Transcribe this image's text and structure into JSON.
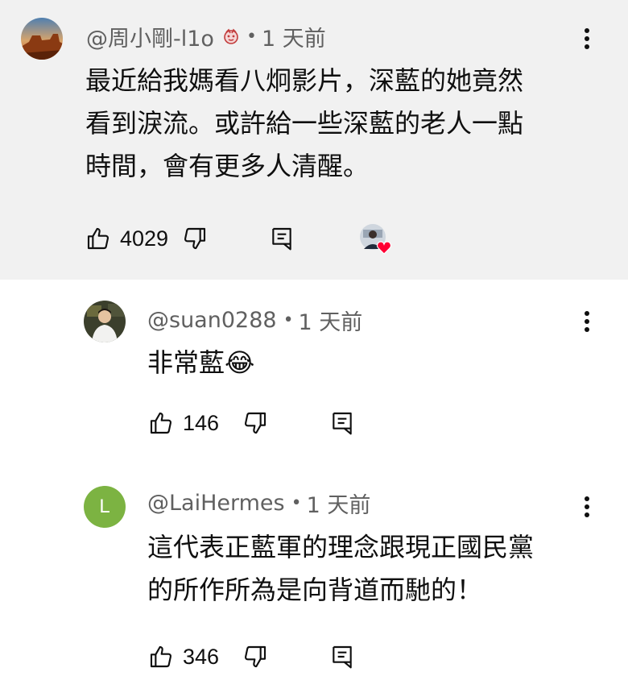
{
  "comments": [
    {
      "handle": "@周小剛-l1o",
      "separator": "•",
      "time": "1 天前",
      "text_lines": [
        "最近給我媽看八炯影片，深藍的她竟然",
        "看到淚流。或許給一些深藍的老人一點",
        "時間，會有更多人清醒。"
      ],
      "likes": "4029",
      "has_creator_heart": true,
      "avatar_icon": "desert-landscape-avatar"
    },
    {
      "handle": "@suan0288",
      "separator": "•",
      "time": "1 天前",
      "text_lines": [
        "非常藍😂"
      ],
      "likes": "146",
      "avatar_icon": "person-photo-avatar"
    },
    {
      "handle": "@LaiHermes",
      "separator": "•",
      "time": "1 天前",
      "text_lines": [
        "這代表正藍軍的理念跟現正國民黨",
        "的所作所為是向背道而馳的！"
      ],
      "likes": "346",
      "avatar_letter": "L",
      "avatar_color": "#7cb342"
    }
  ],
  "colors": {
    "top_comment_bg": "#f1f1f1",
    "meta_text": "#606060",
    "heart": "#ff0033"
  }
}
